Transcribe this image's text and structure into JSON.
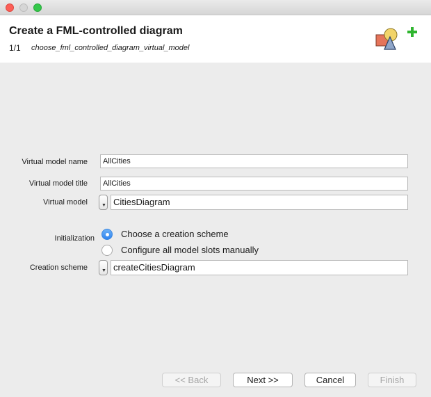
{
  "header": {
    "title": "Create a FML-controlled diagram",
    "step": "1/1",
    "step_name": "choose_fml_controlled_diagram_virtual_model"
  },
  "form": {
    "vm_name": {
      "label": "Virtual model name",
      "value": "AllCities"
    },
    "vm_title": {
      "label": "Virtual model title",
      "value": "AllCities"
    },
    "vm": {
      "label": "Virtual model",
      "value": "CitiesDiagram"
    },
    "init": {
      "label": "Initialization",
      "options": [
        "Choose a creation scheme",
        "Configure all model slots manually"
      ],
      "selected": 0
    },
    "scheme": {
      "label": "Creation scheme",
      "value": "createCitiesDiagram"
    }
  },
  "buttons": {
    "back": "<< Back",
    "next": "Next >>",
    "cancel": "Cancel",
    "finish": "Finish"
  },
  "colors": {
    "accent": "#2f84ef",
    "plus": "#2fb52f"
  }
}
